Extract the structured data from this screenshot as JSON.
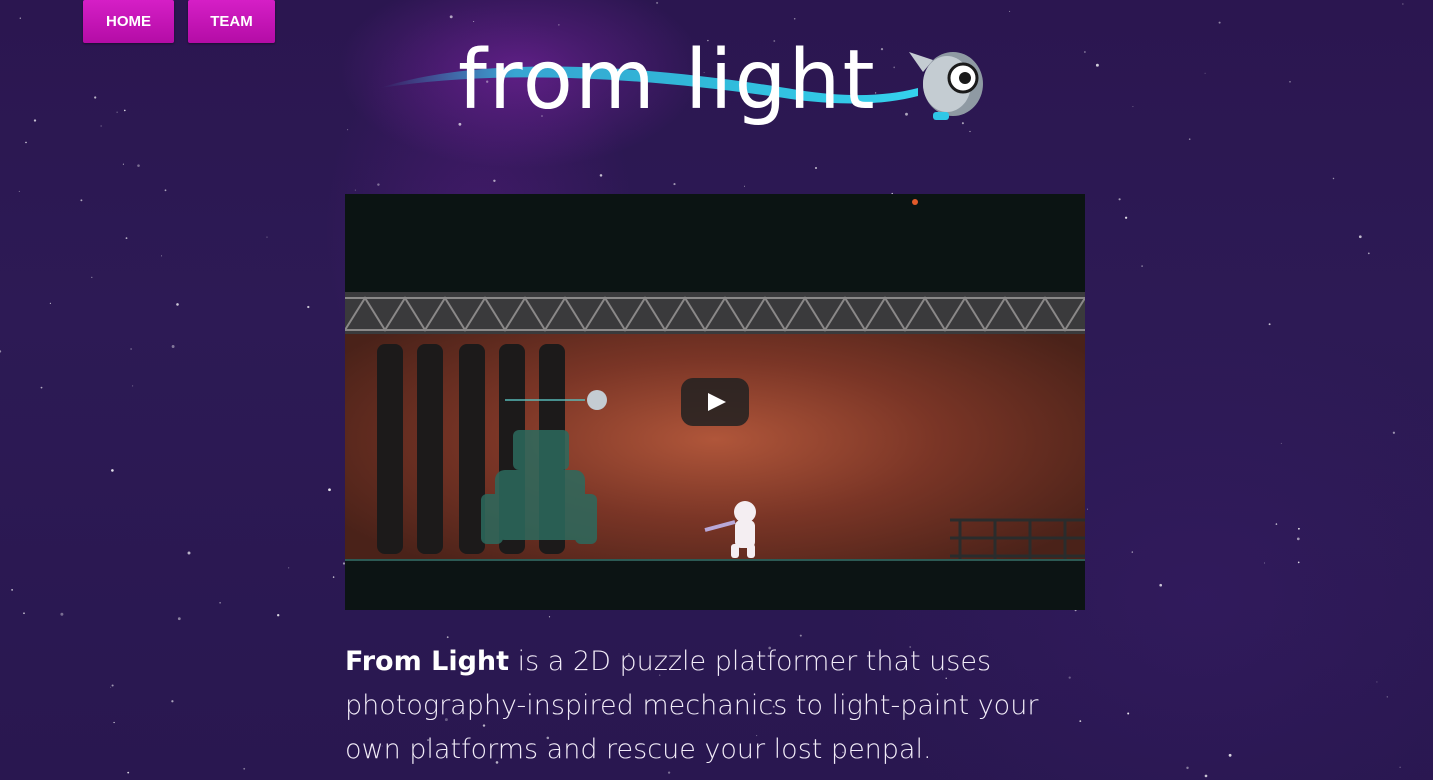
{
  "nav": {
    "home_label": "HOME",
    "team_label": "TEAM"
  },
  "logo": {
    "text": "from light"
  },
  "video": {
    "play_icon": "play-icon"
  },
  "description": {
    "title": "From Light",
    "body": " is a 2D puzzle platformer that uses photography-inspired mechanics to light-paint your own platforms and rescue your lost penpal."
  },
  "colors": {
    "nav_button": "#c414b6",
    "background": "#2b1650",
    "logo_streak": "#2fc7e6",
    "text": "#f2ecf8"
  }
}
